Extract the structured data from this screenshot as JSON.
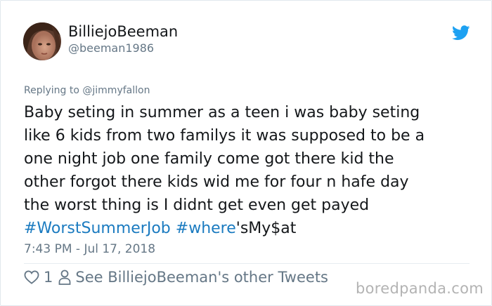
{
  "tweet": {
    "display_name": "BilliejoBeeman",
    "handle": "@beeman1986",
    "reply_prefix": "Replying to",
    "reply_to": "@jimmyfallon",
    "text_lines": [
      "Baby seting in summer as a teen i was baby seting",
      "like 6 kids from two familys it was supposed to be a",
      "one night job one family come got there kid the",
      "other forgot there kids wid me for four n hafe day",
      "the worst thing is I didnt get even get payed"
    ],
    "hashtag_1": "#WorstSummerJob",
    "hashtag_2": "#where",
    "trailing_text": "'sMy$at",
    "timestamp": "7:43 PM - Jul 17, 2018",
    "like_count": "1",
    "profile_link": "See BilliejoBeeman's other Tweets"
  },
  "icons": {
    "brand": "twitter-bird-icon",
    "like": "heart-icon",
    "profile": "person-icon"
  },
  "colors": {
    "link": "#1b7bc0",
    "twitter_blue": "#1da1f2",
    "secondary_text": "#657786",
    "primary_text": "#14171a"
  },
  "watermark": "boredpanda.com"
}
